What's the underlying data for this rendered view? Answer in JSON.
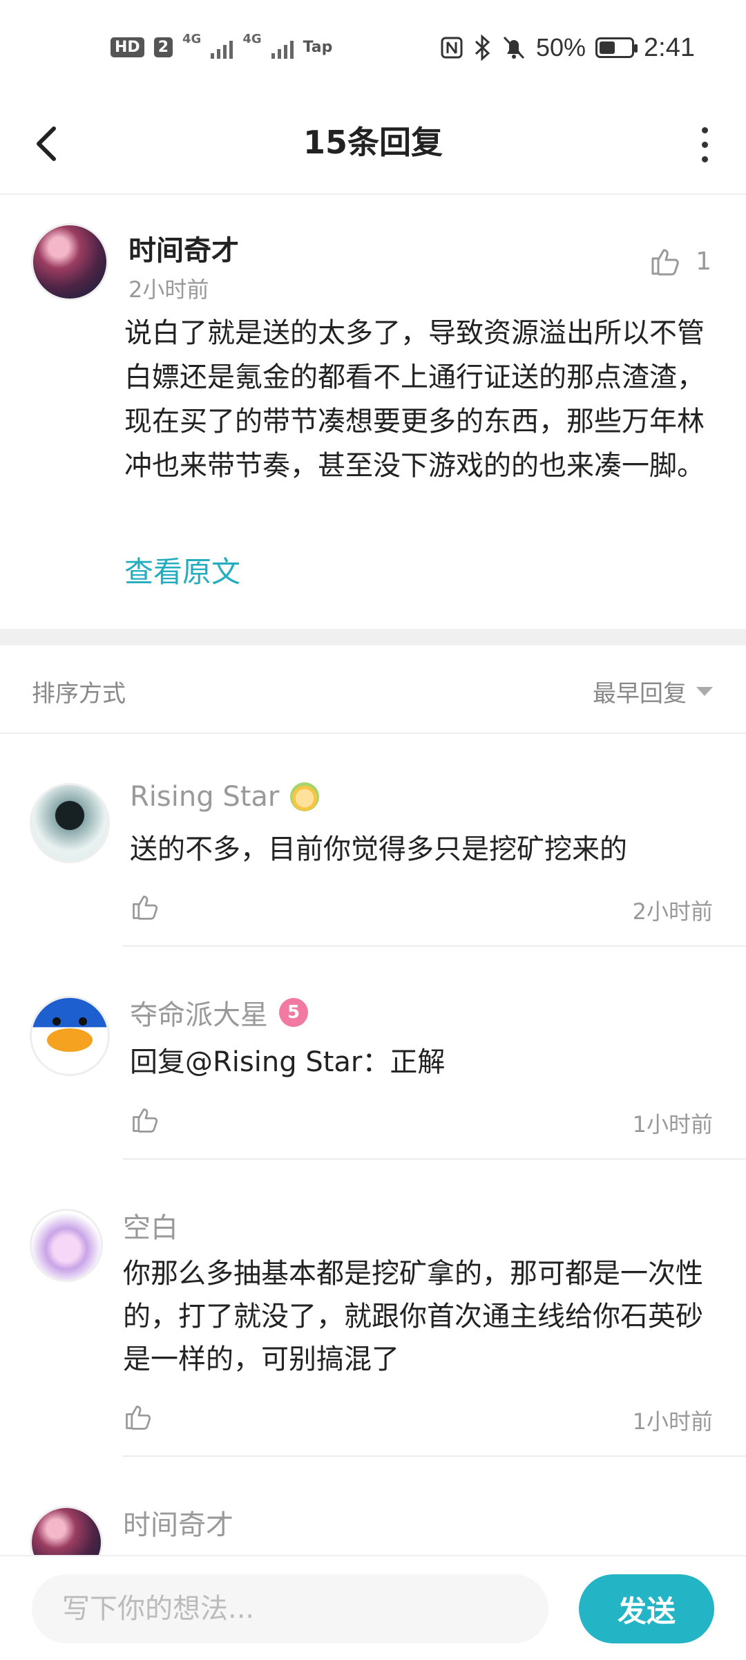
{
  "status_bar": {
    "hd": "HD",
    "sim": "2",
    "net1": "4G",
    "net2": "4G",
    "tap": "Tap",
    "battery_pct": "50%",
    "battery_level": 0.5,
    "time": "2:41"
  },
  "header": {
    "title": "15条回复"
  },
  "main_comment": {
    "author": "时间奇才",
    "time": "2小时前",
    "likes": "1",
    "text": "说白了就是送的太多了，导致资源溢出所以不管白嫖还是氪金的都看不上通行证送的那点渣渣，现在买了的带节凑想要更多的东西，那些万年林冲也来带节奏，甚至没下游戏的的也来凑一脚。",
    "view_original": "查看原文"
  },
  "sort": {
    "label": "排序方式",
    "value": "最早回复"
  },
  "replies": [
    {
      "author": "Rising Star",
      "text": "送的不多，目前你觉得多只是挖矿挖来的",
      "time": "2小时前"
    },
    {
      "author": "夺命派大星",
      "badge": "5",
      "text": "回复@Rising Star：正解",
      "time": "1小时前"
    },
    {
      "author": "空白",
      "text": "你那么多抽基本都是挖矿拿的，那可都是一次性的，打了就没了，就跟你首次通主线给你石英砂是一样的，可别搞混了",
      "time": "1小时前"
    },
    {
      "author": "时间奇才"
    }
  ],
  "composer": {
    "placeholder": "写下你的想法...",
    "send_label": "发送"
  },
  "colors": {
    "accent": "#23b5c6",
    "link": "#23adbe"
  }
}
